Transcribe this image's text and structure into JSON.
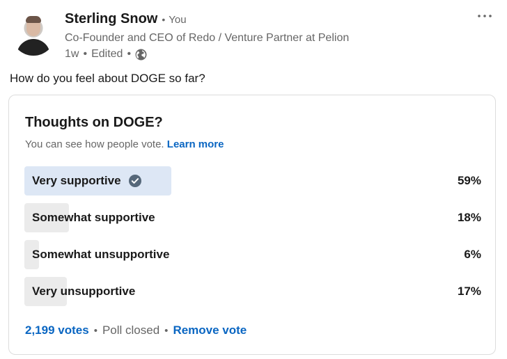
{
  "author": {
    "name": "Sterling Snow",
    "relation": "You",
    "headline": "Co-Founder and CEO of Redo / Venture Partner at Pelion",
    "time": "1w",
    "edited": "Edited",
    "visibility_icon": "globe-icon",
    "separator": "•"
  },
  "post": {
    "text": "How do you feel about DOGE so far?"
  },
  "poll": {
    "title": "Thoughts on DOGE?",
    "subtitle": "You can see how people vote.",
    "learn_more": "Learn more",
    "options": [
      {
        "label": "Very supportive",
        "percent_label": "59%",
        "percent": 59,
        "selected": true
      },
      {
        "label": "Somewhat supportive",
        "percent_label": "18%",
        "percent": 18,
        "selected": false
      },
      {
        "label": "Somewhat unsupportive",
        "percent_label": "6%",
        "percent": 6,
        "selected": false
      },
      {
        "label": "Very unsupportive",
        "percent_label": "17%",
        "percent": 17,
        "selected": false
      }
    ],
    "votes": "2,199 votes",
    "status": "Poll closed",
    "remove_vote": "Remove vote"
  },
  "colors": {
    "link": "#0a66c2",
    "bar": "#ebebeb",
    "bar_selected": "#dde7f5",
    "check": "#56687a"
  }
}
